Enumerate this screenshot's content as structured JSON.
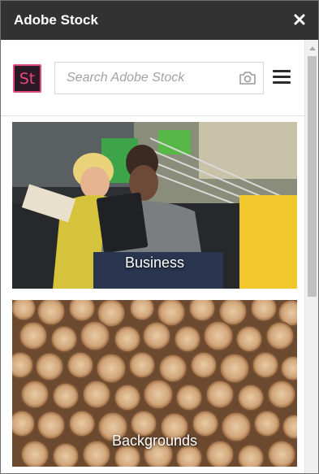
{
  "panel": {
    "title": "Adobe Stock"
  },
  "header": {
    "logo_text": "St",
    "search": {
      "placeholder": "Search Adobe Stock",
      "value": ""
    },
    "icons": [
      "camera-icon",
      "hamburger-menu-icon",
      "close-icon"
    ]
  },
  "categories": [
    {
      "label": "Business"
    },
    {
      "label": "Backgrounds"
    }
  ],
  "colors": {
    "titlebar": "#323232",
    "logo_bg": "#2b1a26",
    "logo_accent": "#e34a80",
    "search_border": "#d6d6d6",
    "scroll_thumb": "#c1c1c1"
  }
}
